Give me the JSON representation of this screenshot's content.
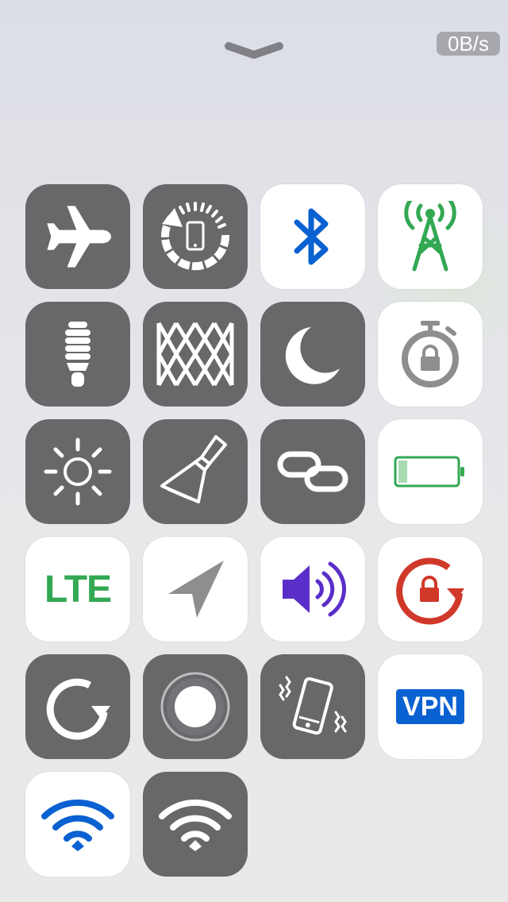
{
  "status": {
    "network_speed": "0B/s"
  },
  "handle": {
    "icon": "chevron-down-icon"
  },
  "tiles": [
    {
      "id": "airplane",
      "icon": "airplane-icon",
      "state": "off"
    },
    {
      "id": "data-saver",
      "icon": "phone-rotation-icon",
      "state": "off"
    },
    {
      "id": "bluetooth",
      "icon": "bluetooth-icon",
      "state": "on",
      "color": "#0a61d1"
    },
    {
      "id": "cellular-data",
      "icon": "cell-tower-icon",
      "state": "on",
      "color": "#33a853"
    },
    {
      "id": "low-power",
      "icon": "lightbulb-icon",
      "state": "off"
    },
    {
      "id": "pattern",
      "icon": "pattern-icon",
      "state": "off"
    },
    {
      "id": "do-not-disturb",
      "icon": "moon-icon",
      "state": "off"
    },
    {
      "id": "timer-lock",
      "icon": "stopwatch-lock-icon",
      "state": "on",
      "color": "#8e8e8e"
    },
    {
      "id": "brightness",
      "icon": "sun-icon",
      "state": "off"
    },
    {
      "id": "clear-cache",
      "icon": "broom-icon",
      "state": "off"
    },
    {
      "id": "link",
      "icon": "link-icon",
      "state": "off"
    },
    {
      "id": "battery",
      "icon": "battery-icon",
      "state": "on",
      "color": "#33a853",
      "level": 0.15
    },
    {
      "id": "lte",
      "icon": "lte-icon",
      "label": "LTE",
      "state": "on",
      "color": "#33a853"
    },
    {
      "id": "location",
      "icon": "location-arrow-icon",
      "state": "on",
      "color": "#8e8e8e"
    },
    {
      "id": "volume",
      "icon": "speaker-icon",
      "state": "on",
      "color": "#5a2ec9"
    },
    {
      "id": "rotation-lock",
      "icon": "rotation-lock-icon",
      "state": "on",
      "color": "#d0382a"
    },
    {
      "id": "refresh",
      "icon": "refresh-icon",
      "state": "off"
    },
    {
      "id": "assistive-touch",
      "icon": "assistive-touch-icon",
      "state": "off"
    },
    {
      "id": "vibrate",
      "icon": "vibrate-phone-icon",
      "state": "off"
    },
    {
      "id": "vpn",
      "icon": "vpn-icon",
      "label": "VPN",
      "state": "on",
      "color": "#0a61d1"
    },
    {
      "id": "wifi",
      "icon": "wifi-icon",
      "state": "on",
      "color": "#0a61d1"
    },
    {
      "id": "wifi-hotspot",
      "icon": "wifi-icon",
      "state": "off"
    }
  ]
}
